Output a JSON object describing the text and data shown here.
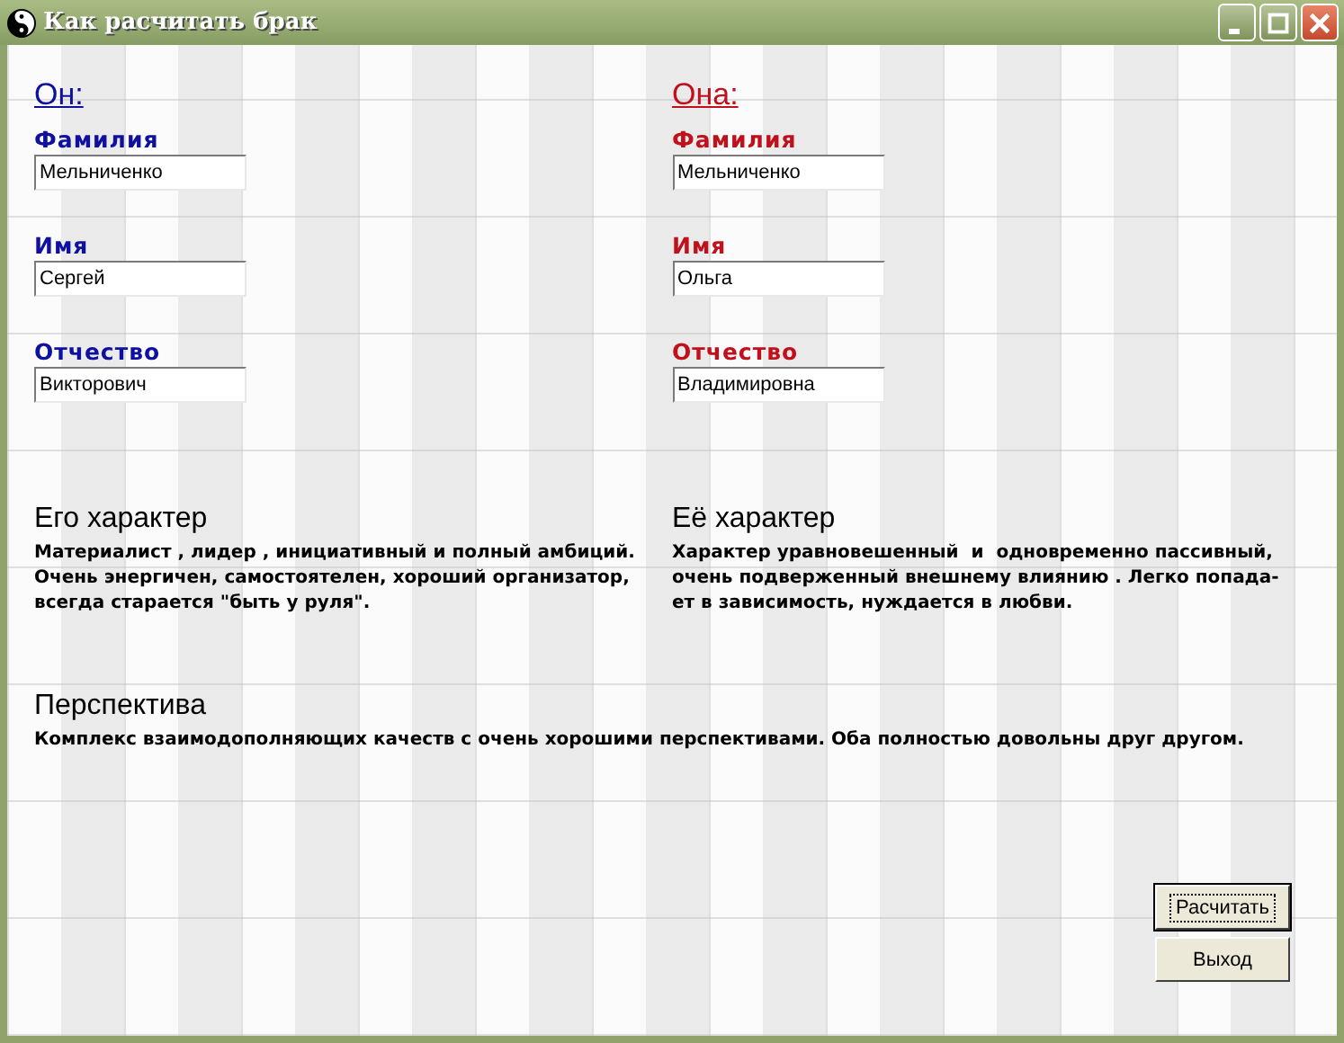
{
  "window": {
    "title": "Как расчитать брак"
  },
  "persons": [
    {
      "heading": "Он:",
      "color": "#1010a0",
      "fields": [
        {
          "label": "Фамилия",
          "value": "Мельниченко"
        },
        {
          "label": "Имя",
          "value": "Сергей"
        },
        {
          "label": "Отчество",
          "value": "Викторович"
        }
      ],
      "character_title": "Его характер",
      "character_text": "Материалист , лидер , инициативный и полный амбиций.\nОчень энергичен, самостоятелен, хороший организатор,\nвсегда старается \"быть у руля\"."
    },
    {
      "heading": "Она:",
      "color": "#c0101c",
      "fields": [
        {
          "label": "Фамилия",
          "value": "Мельниченко"
        },
        {
          "label": "Имя",
          "value": "Ольга"
        },
        {
          "label": "Отчество",
          "value": "Владимировна"
        }
      ],
      "character_title": "Её характер",
      "character_text": "Характер уравновешенный  и  одновременно пассивный,\nочень подверженный внешнему влиянию . Легко попада-\nет в зависимость, нуждается в любви."
    }
  ],
  "perspective": {
    "title": "Перспектива",
    "text": "Комплекс взаимодополняющих качеств с очень хорошими перспективами. Оба полностью довольны друг другом."
  },
  "buttons": [
    {
      "label": "Расчитать",
      "focused": true
    },
    {
      "label": "Выход",
      "focused": false
    }
  ]
}
